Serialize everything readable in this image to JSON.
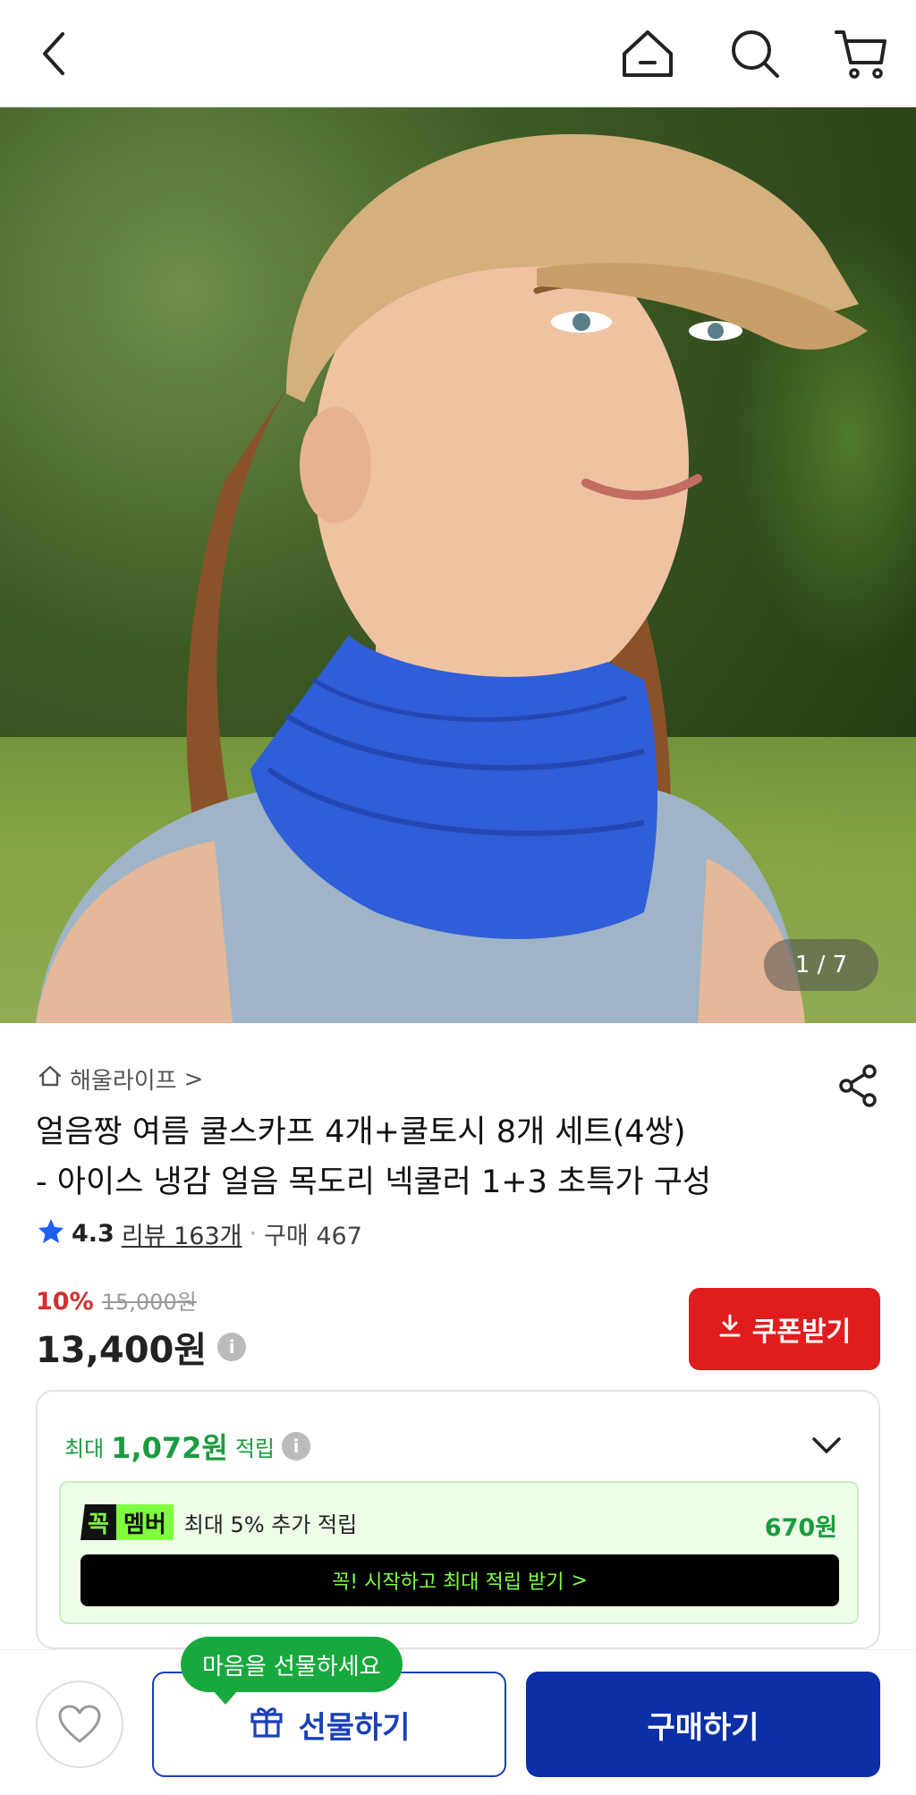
{
  "header": {
    "icons": [
      "back-icon",
      "home-icon",
      "search-icon",
      "cart-icon"
    ]
  },
  "hero": {
    "pager": "1 / 7"
  },
  "store": {
    "name": "해울라이프",
    "chevron": ">"
  },
  "product": {
    "title_line1": "얼음짱 여름 쿨스카프 4개+쿨토시 8개 세트(4쌍)",
    "title_line2": "- 아이스 냉감 얼음 목도리 넥쿨러 1+3 초특가 구성",
    "rating": "4.3",
    "review": "리뷰 163개",
    "dot": "·",
    "purchase": "구매 467"
  },
  "price": {
    "discount": "10%",
    "original": "15,000원",
    "final": "13,400원",
    "info": "i"
  },
  "coupon": {
    "label": "쿠폰받기"
  },
  "reward": {
    "prefix": "최대",
    "amount": "1,072원",
    "suffix": "적립",
    "info": "i",
    "member_badge_1": "꼭",
    "member_badge_2": "멤버",
    "member_text": "최대 5% 추가 적립",
    "member_amount": "670원",
    "member_button": "꼭! 시작하고 최대 적립 받기",
    "member_button_chevron": ">"
  },
  "bottom": {
    "bubble": "마음을 선물하세요",
    "gift": "선물하기",
    "buy": "구매하기"
  },
  "colors": {
    "coupon": "#e01d1d",
    "buy": "#0a2fa6",
    "reward_green": "#1a9c3e",
    "member_lime": "#7fff3e"
  }
}
